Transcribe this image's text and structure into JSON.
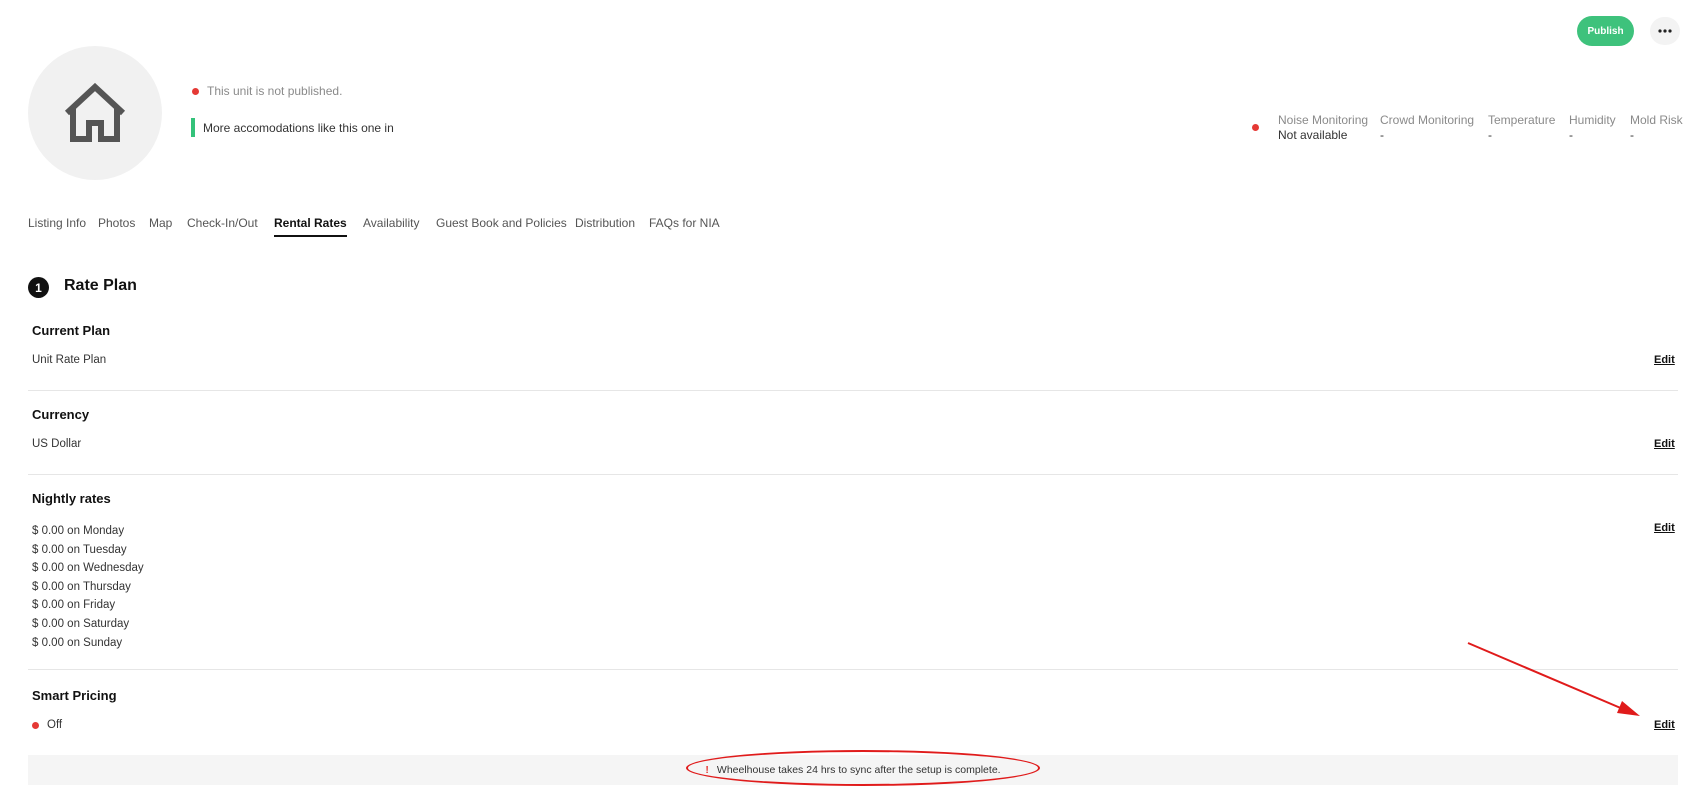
{
  "header": {
    "status_text": "This unit is not published.",
    "more_text": "More accomodations like this one in",
    "publish_label": "Publish",
    "more_options_icon": "more-horizontal-icon",
    "avatar_icon": "house-icon"
  },
  "monitoring": [
    {
      "label": "Noise Monitoring",
      "value": "Not available"
    },
    {
      "label": "Crowd Monitoring",
      "value": "-"
    },
    {
      "label": "Temperature",
      "value": "-"
    },
    {
      "label": "Humidity",
      "value": "-"
    },
    {
      "label": "Mold Risk",
      "value": "-"
    }
  ],
  "tabs": [
    {
      "label": "Listing Info"
    },
    {
      "label": "Photos"
    },
    {
      "label": "Map"
    },
    {
      "label": "Check-In/Out"
    },
    {
      "label": "Rental Rates",
      "active": true
    },
    {
      "label": "Availability"
    },
    {
      "label": "Guest Book and Policies"
    },
    {
      "label": "Distribution"
    },
    {
      "label": "FAQs for NIA"
    }
  ],
  "section": {
    "number": "1",
    "title": "Rate Plan"
  },
  "rows": {
    "current_plan": {
      "title": "Current Plan",
      "value": "Unit Rate Plan",
      "edit": "Edit"
    },
    "currency": {
      "title": "Currency",
      "value": "US Dollar",
      "edit": "Edit"
    },
    "nightly_rates": {
      "title": "Nightly rates",
      "edit": "Edit",
      "values": [
        "$ 0.00 on Monday",
        "$ 0.00 on Tuesday",
        "$ 0.00 on Wednesday",
        "$ 0.00 on Thursday",
        "$ 0.00 on Friday",
        "$ 0.00 on Saturday",
        "$ 0.00 on Sunday"
      ]
    },
    "smart_pricing": {
      "title": "Smart Pricing",
      "status": "Off",
      "edit": "Edit"
    }
  },
  "banner": {
    "mark": "!",
    "text": "Wheelhouse takes 24 hrs to sync after the setup is complete."
  },
  "colors": {
    "publish": "#3ec27c",
    "status_red": "#e53935",
    "accent_green": "#34c27a",
    "annotation": "#e01b1b"
  }
}
